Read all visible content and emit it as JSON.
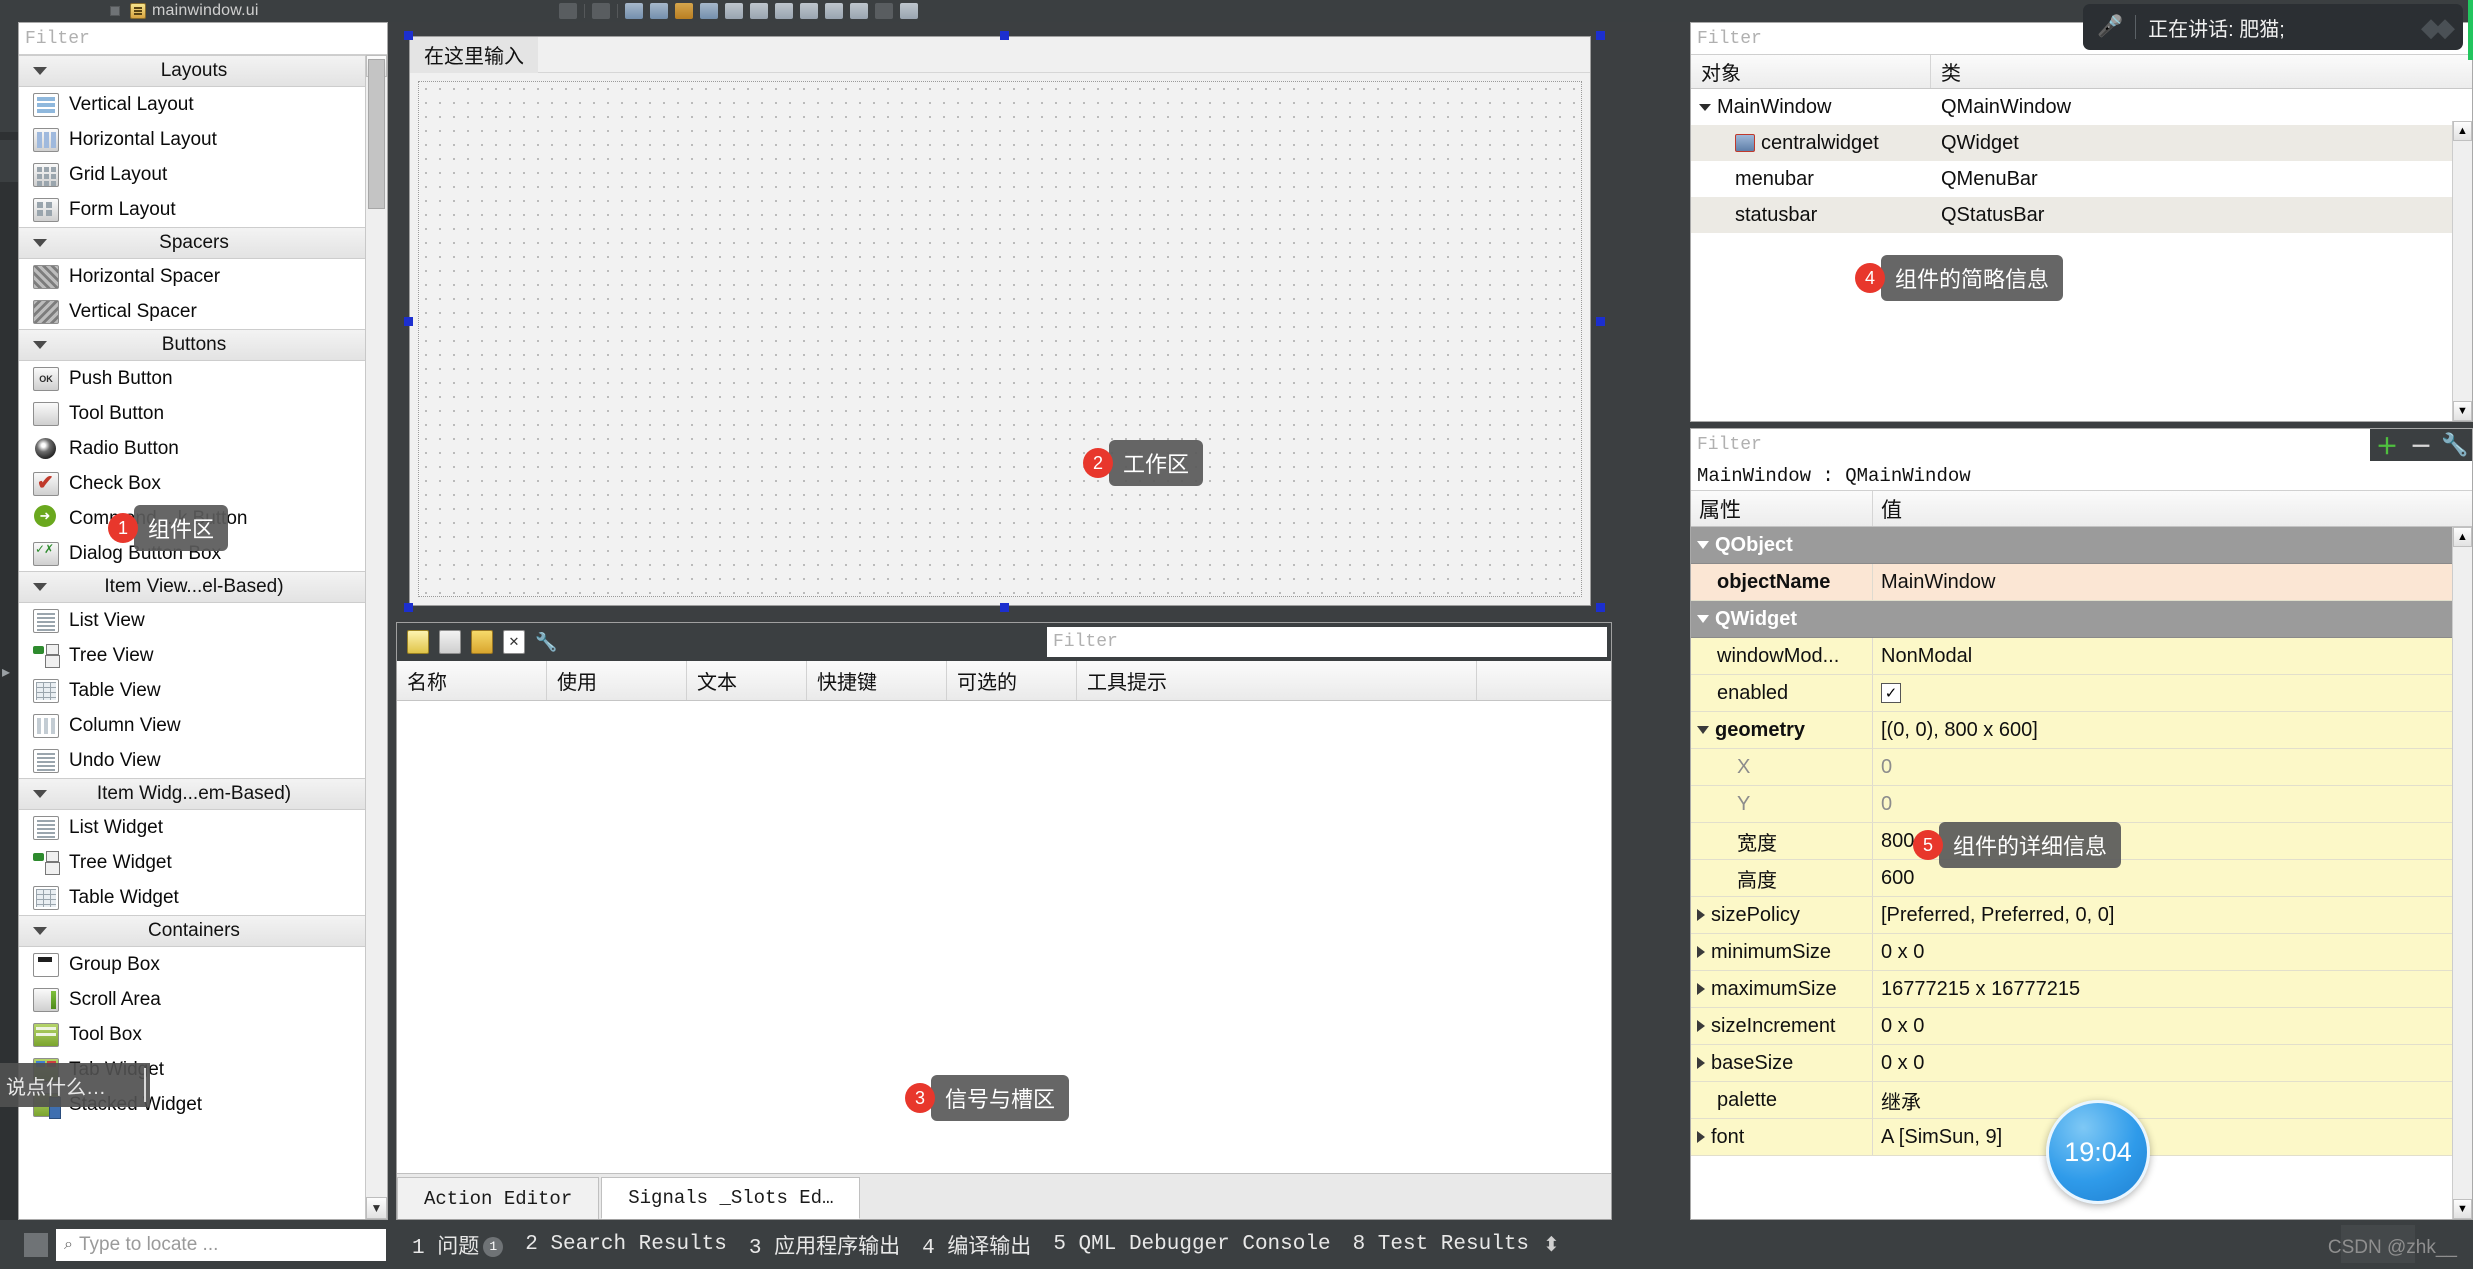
{
  "topbar": {
    "title": "mainwindow.ui",
    "doc_icon": "document-icon"
  },
  "speech_overlay": {
    "mic_icon": "microphone-icon",
    "text": "正在讲话: 肥猫;"
  },
  "widget_box": {
    "filter_placeholder": "Filter",
    "groups": [
      {
        "label": "Layouts",
        "items": [
          {
            "label": "Vertical Layout",
            "icon": "vertical-layout-icon"
          },
          {
            "label": "Horizontal Layout",
            "icon": "horizontal-layout-icon"
          },
          {
            "label": "Grid Layout",
            "icon": "grid-layout-icon"
          },
          {
            "label": "Form Layout",
            "icon": "form-layout-icon"
          }
        ]
      },
      {
        "label": "Spacers",
        "items": [
          {
            "label": "Horizontal Spacer",
            "icon": "horizontal-spacer-icon"
          },
          {
            "label": "Vertical Spacer",
            "icon": "vertical-spacer-icon"
          }
        ]
      },
      {
        "label": "Buttons",
        "items": [
          {
            "label": "Push Button",
            "icon": "push-button-icon"
          },
          {
            "label": "Tool Button",
            "icon": "tool-button-icon"
          },
          {
            "label": "Radio Button",
            "icon": "radio-button-icon"
          },
          {
            "label": "Check Box",
            "icon": "check-box-icon"
          },
          {
            "label": "Command ...k Button",
            "icon": "command-link-button-icon"
          },
          {
            "label": "Dialog Button Box",
            "icon": "dialog-button-box-icon"
          }
        ]
      },
      {
        "label": "Item View...el-Based)",
        "items": [
          {
            "label": "List View",
            "icon": "list-view-icon"
          },
          {
            "label": "Tree View",
            "icon": "tree-view-icon"
          },
          {
            "label": "Table View",
            "icon": "table-view-icon"
          },
          {
            "label": "Column View",
            "icon": "column-view-icon"
          },
          {
            "label": "Undo View",
            "icon": "undo-view-icon"
          }
        ]
      },
      {
        "label": "Item Widg...em-Based)",
        "items": [
          {
            "label": "List Widget",
            "icon": "list-widget-icon"
          },
          {
            "label": "Tree Widget",
            "icon": "tree-widget-icon"
          },
          {
            "label": "Table Widget",
            "icon": "table-widget-icon"
          }
        ]
      },
      {
        "label": "Containers",
        "items": [
          {
            "label": "Group Box",
            "icon": "group-box-icon"
          },
          {
            "label": "Scroll Area",
            "icon": "scroll-area-icon"
          },
          {
            "label": "Tool Box",
            "icon": "tool-box-icon"
          },
          {
            "label": "Tab Widget",
            "icon": "tab-widget-icon"
          },
          {
            "label": "Stacked Widget",
            "icon": "stacked-widget-icon"
          }
        ]
      }
    ]
  },
  "form_canvas": {
    "menubar_placeholder": "在这里输入"
  },
  "action_editor": {
    "toolbar_icons": [
      "new-action-icon",
      "copy-icon",
      "paste-icon",
      "delete-icon",
      "configure-icon"
    ],
    "filter_placeholder": "Filter",
    "columns": [
      "名称",
      "使用",
      "文本",
      "快捷键",
      "可选的",
      "工具提示"
    ],
    "tabs": [
      {
        "label": "Action Editor",
        "active": false
      },
      {
        "label": "Signals _Slots Ed…",
        "active": true
      }
    ]
  },
  "object_inspector": {
    "filter_placeholder": "Filter",
    "columns": [
      "对象",
      "类"
    ],
    "rows": [
      {
        "object": "MainWindow",
        "class": "QMainWindow",
        "indent": 0,
        "expander": true,
        "icon": null
      },
      {
        "object": "centralwidget",
        "class": "QWidget",
        "indent": 1,
        "expander": false,
        "icon": "central-widget-icon"
      },
      {
        "object": "menubar",
        "class": "QMenuBar",
        "indent": 1,
        "expander": false,
        "icon": null
      },
      {
        "object": "statusbar",
        "class": "QStatusBar",
        "indent": 1,
        "expander": false,
        "icon": null
      }
    ]
  },
  "property_editor": {
    "filter_placeholder": "Filter",
    "toolbar_icons": [
      "add-icon",
      "remove-icon",
      "configure-icon"
    ],
    "subject": "MainWindow : QMainWindow",
    "columns": [
      "属性",
      "值"
    ],
    "rows": [
      {
        "name": "QObject",
        "value": "",
        "kind": "group"
      },
      {
        "name": "objectName",
        "value": "MainWindow",
        "kind": "peach",
        "bold": true
      },
      {
        "name": "QWidget",
        "value": "",
        "kind": "group"
      },
      {
        "name": "windowMod...",
        "value": "NonModal",
        "kind": "yellow"
      },
      {
        "name": "enabled",
        "value": "",
        "kind": "yellow",
        "checkbox": true
      },
      {
        "name": "geometry",
        "value": "[(0, 0), 800 x 600]",
        "kind": "yellow",
        "bold": true,
        "expander": "down"
      },
      {
        "name": "X",
        "value": "0",
        "kind": "yellow",
        "child": true
      },
      {
        "name": "Y",
        "value": "0",
        "kind": "yellow",
        "child": true
      },
      {
        "name": "宽度",
        "value": "800",
        "kind": "yellow",
        "child": true
      },
      {
        "name": "高度",
        "value": "600",
        "kind": "yellow",
        "child": true
      },
      {
        "name": "sizePolicy",
        "value": "[Preferred, Preferred, 0, 0]",
        "kind": "yellow",
        "expander": "right"
      },
      {
        "name": "minimumSize",
        "value": "0 x 0",
        "kind": "yellow",
        "expander": "right"
      },
      {
        "name": "maximumSize",
        "value": "16777215 x 16777215",
        "kind": "yellow",
        "expander": "right"
      },
      {
        "name": "sizeIncrement",
        "value": "0 x 0",
        "kind": "yellow",
        "expander": "right"
      },
      {
        "name": "baseSize",
        "value": "0 x 0",
        "kind": "yellow",
        "expander": "right"
      },
      {
        "name": "palette",
        "value": "继承",
        "kind": "yellow"
      },
      {
        "name": "font",
        "value": "A  [SimSun, 9]",
        "kind": "yellow",
        "expander": "right"
      }
    ]
  },
  "annotations": [
    {
      "num": "1",
      "text": "组件区"
    },
    {
      "num": "2",
      "text": "工作区"
    },
    {
      "num": "3",
      "text": "信号与槽区"
    },
    {
      "num": "4",
      "text": "组件的简略信息"
    },
    {
      "num": "5",
      "text": "组件的详细信息"
    }
  ],
  "ime": {
    "text": "说点什么…"
  },
  "clock": {
    "time": "19:04"
  },
  "statusbar": {
    "locator_placeholder": "Type to locate ...",
    "search_icon": "magnifier-icon",
    "items": [
      {
        "num": "1",
        "label": "问题",
        "badge": "1"
      },
      {
        "num": "2",
        "label": "Search Results",
        "badge": null
      },
      {
        "num": "3",
        "label": "应用程序输出",
        "badge": null
      },
      {
        "num": "4",
        "label": "编译输出",
        "badge": null
      },
      {
        "num": "5",
        "label": "QML Debugger Console",
        "badge": null
      },
      {
        "num": "8",
        "label": "Test Results",
        "badge": null
      }
    ],
    "updown_icon": "up-down-arrows-icon",
    "watermark": "CSDN @zhk__"
  }
}
